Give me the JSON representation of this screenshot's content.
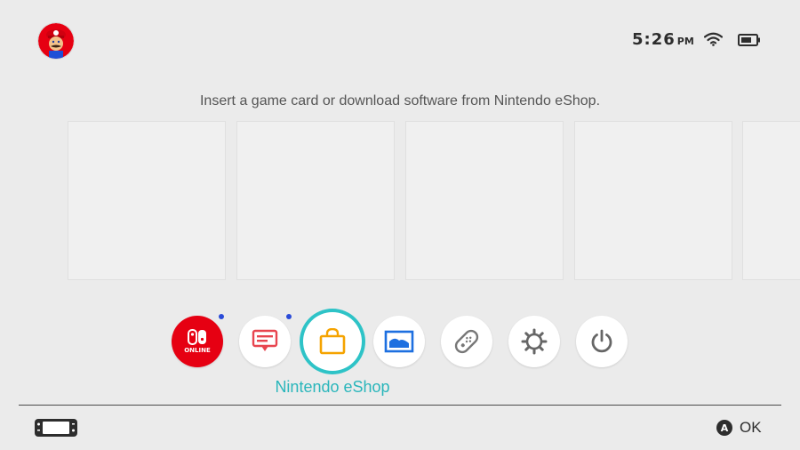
{
  "status_bar": {
    "time": "5:26",
    "ampm": "PM"
  },
  "hint_text": "Insert a game card or download software from Nintendo eShop.",
  "menu": {
    "online_label": "ONLINE",
    "selected_label": "Nintendo eShop",
    "items": [
      {
        "name": "nintendo-switch-online",
        "icon": "switch-online-icon",
        "color": "#e60012",
        "notification": true
      },
      {
        "name": "news",
        "icon": "news-icon",
        "color": "#e8454f",
        "notification": true
      },
      {
        "name": "nintendo-eshop",
        "icon": "shopping-bag-icon",
        "color": "#f5a300",
        "notification": false,
        "selected": true
      },
      {
        "name": "album",
        "icon": "album-icon",
        "color": "#1d6fe0",
        "notification": false
      },
      {
        "name": "controllers",
        "icon": "joycon-icon",
        "color": "#777777",
        "notification": false
      },
      {
        "name": "system-settings",
        "icon": "gear-icon",
        "color": "#666666",
        "notification": false
      },
      {
        "name": "sleep-mode",
        "icon": "power-icon",
        "color": "#666666",
        "notification": false
      }
    ]
  },
  "footer": {
    "a_button": "A",
    "ok_label": "OK"
  },
  "colors": {
    "background": "#ebebeb",
    "accent": "#2ec3c7",
    "online_red": "#e60012"
  }
}
